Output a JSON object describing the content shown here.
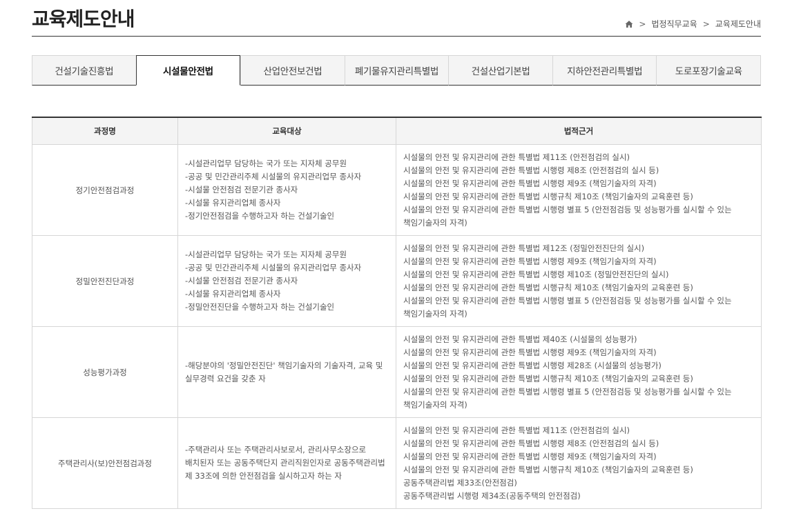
{
  "header": {
    "title": "교육제도안내",
    "breadcrumb": [
      "법정직무교육",
      "교육제도안내"
    ],
    "separator": ">"
  },
  "tabs": [
    {
      "label": "건설기술진흥법",
      "active": false
    },
    {
      "label": "시설물안전법",
      "active": true
    },
    {
      "label": "산업안전보건법",
      "active": false
    },
    {
      "label": "폐기물유지관리특별법",
      "active": false
    },
    {
      "label": "건설산업기본법",
      "active": false
    },
    {
      "label": "지하안전관리특별법",
      "active": false
    },
    {
      "label": "도로포장기술교육",
      "active": false
    }
  ],
  "table": {
    "headers": [
      "과정명",
      "교육대상",
      "법적근거"
    ],
    "rows": [
      {
        "course": "정기안전점검과정",
        "target": [
          "-시설관리업무 담당하는 국가 또는 지자체 공무원",
          "-공공 및 민간관리주체 시설물의 유지관리업무 종사자",
          "-시설물 안전점검 전문기관 종사자",
          "-시설물 유지관리업체 종사자",
          "-정기안전점검을 수행하고자 하는 건설기술인"
        ],
        "legal": [
          "시설물의 안전 및 유지관리에 관한 특별법 제11조 (안전점검의 실시)",
          "시설물의 안전 및 유지관리에 관한 특별법 시행령 제8조 (안전점검의 실시 등)",
          "시설물의 안전 및 유지관리에 관한 특별법 시행령 제9조 (책임기술자의 자격)",
          "시설물의 안전 및 유지관리에 관한 특별법 시행규칙 제10조 (책임기술자의 교육훈련 등)",
          "시설물의 안전 및 유지관리에 관한 특별법 시행령 별표 5 (안전점검등 및 성능평가를 실시할 수 있는",
          "책임기술자의 자격)"
        ]
      },
      {
        "course": "정밀안전진단과정",
        "target": [
          "-시설관리업무 담당하는 국가 또는 지자체 공무원",
          "-공공 및 민간관리주체 시설물의 유지관리업무 종사자",
          "-시설물 안전점검 전문기관 종사자",
          "-시설물 유지관리업체 종사자",
          "-정밀안전진단을 수행하고자 하는 건설기술인"
        ],
        "legal": [
          "시설물의 안전 및 유지관리에 관한 특별법 제12조 (정밀안전진단의 실시)",
          "시설물의 안전 및 유지관리에 관한 특별법 시행령 제9조 (책임기술자의 자격)",
          "시설물의 안전 및 유지관리에 관한 특별법 시행령 제10조 (정밀안전진단의 실시)",
          "시설물의 안전 및 유지관리에 관한 특별법 시행규칙 제10조 (책임기술자의 교육훈련 등)",
          "시설물의 안전 및 유지관리에 관한 특별법 시행령 별표 5 (안전점검등 및 성능평가를 실시할 수 있는",
          "책임기술자의 자격)"
        ]
      },
      {
        "course": "성능평가과정",
        "target": [
          "-해당분야의 '정밀안전진단' 책임기술자의 기술자격, 교육 및",
          "실무경력 요건을 갖춘 자"
        ],
        "legal": [
          "시설물의 안전 및 유지관리에 관한 특별법 제40조 (시설물의 성능평가)",
          "시설물의 안전 및 유지관리에 관한 특별법 시행령 제9조 (책임기술자의 자격)",
          "시설물의 안전 및 유지관리에 관한 특별법 시행령 제28조 (시설물의 성능평가)",
          "시설물의 안전 및 유지관리에 관한 특별법 시행규칙 제10조 (책임기술자의 교육훈련 등)",
          "시설물의 안전 및 유지관리에 관한 특별법 시행령 별표 5 (안전점검등 및 성능평가를 실시할 수 있는",
          "책임기술자의 자격)"
        ]
      },
      {
        "course": "주택관리사(보)안전점검과정",
        "target": [
          "-주택관리사 또는 주택관리사보로서, 관리사무소장으로",
          "배치된자 또는 공동주택단지 관리직원인자로 공동주택관리법",
          "제 33조에 의한 안전점검을 실시하고자 하는 자"
        ],
        "legal": [
          "시설물의 안전 및 유지관리에 관한 특별법 제11조 (안전점검의 실시)",
          "시설물의 안전 및 유지관리에 관한 특별법 시행령 제8조 (안전점검의 실시 등)",
          "시설물의 안전 및 유지관리에 관한 특별법 시행령 제9조 (책임기술자의 자격)",
          "시설물의 안전 및 유지관리에 관한 특별법 시행규칙 제10조 (책임기술자의 교육훈련 등)",
          "공동주택관리법 제33조(안전점검)",
          "공동주택관리법 시행령 제34조(공동주택의 안전점검)"
        ]
      }
    ]
  }
}
